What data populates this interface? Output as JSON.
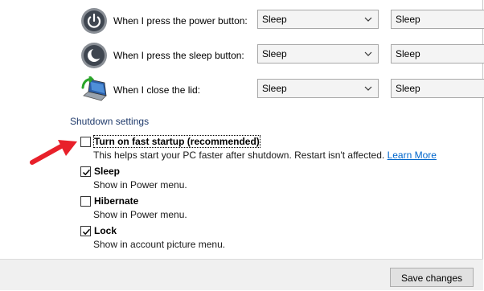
{
  "power_button_row": {
    "label": "When I press the power button:",
    "on_battery": "Sleep",
    "plugged_in": "Sleep"
  },
  "sleep_button_row": {
    "label": "When I press the sleep button:",
    "on_battery": "Sleep",
    "plugged_in": "Sleep"
  },
  "lid_row": {
    "label": "When I close the lid:",
    "on_battery": "Sleep",
    "plugged_in": "Sleep"
  },
  "shutdown": {
    "title": "Shutdown settings",
    "options": [
      {
        "label": "Turn on fast startup (recommended)",
        "checked": false,
        "description": "This helps start your PC faster after shutdown. Restart isn't affected.",
        "link": "Learn More"
      },
      {
        "label": "Sleep",
        "checked": true,
        "description": "Show in Power menu."
      },
      {
        "label": "Hibernate",
        "checked": false,
        "description": "Show in Power menu."
      },
      {
        "label": "Lock",
        "checked": true,
        "description": "Show in account picture menu."
      }
    ]
  },
  "footer": {
    "save_label": "Save changes"
  },
  "colors": {
    "arrow": "#e8202a",
    "link": "#0066cc",
    "section_title": "#1f3a6b"
  },
  "icons": [
    "power-icon",
    "sleep-moon-icon",
    "laptop-lid-icon",
    "chevron-down-icon",
    "checkmark-icon",
    "red-arrow"
  ]
}
